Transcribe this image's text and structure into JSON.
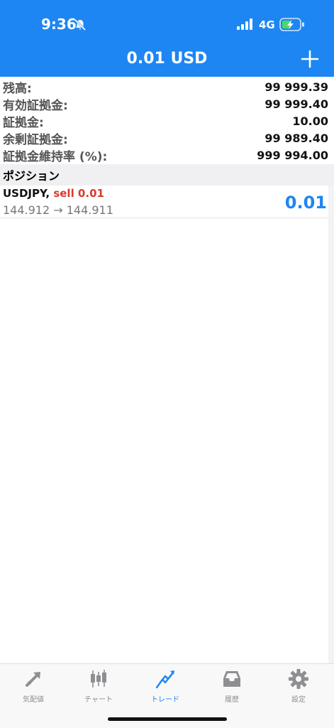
{
  "status_bar": {
    "time": "9:36",
    "network": "4G"
  },
  "header": {
    "title": "0.01 USD"
  },
  "account": [
    {
      "label": "残高:",
      "value": "99 999.39"
    },
    {
      "label": "有効証拠金:",
      "value": "99 999.40"
    },
    {
      "label": "証拠金:",
      "value": "10.00"
    },
    {
      "label": "余剰証拠金:",
      "value": "99 989.40"
    },
    {
      "label": "証拠金維持率 (%):",
      "value": "999 994.00"
    }
  ],
  "positions_section": {
    "title": "ポジション"
  },
  "position": {
    "symbol": "USDJPY,",
    "side": "sell 0.01",
    "prices": "144.912 → 144.911",
    "profit": "0.01"
  },
  "tabs": [
    {
      "label": "気配値",
      "icon": "quotes-icon",
      "active": false
    },
    {
      "label": "チャート",
      "icon": "candlestick-chart-icon",
      "active": false
    },
    {
      "label": "トレード",
      "icon": "trade-icon",
      "active": true
    },
    {
      "label": "履歴",
      "icon": "history-inbox-icon",
      "active": false
    },
    {
      "label": "設定",
      "icon": "gear-icon",
      "active": false
    }
  ],
  "colors": {
    "accent": "#1d86f2",
    "sell": "#d93a2c"
  }
}
